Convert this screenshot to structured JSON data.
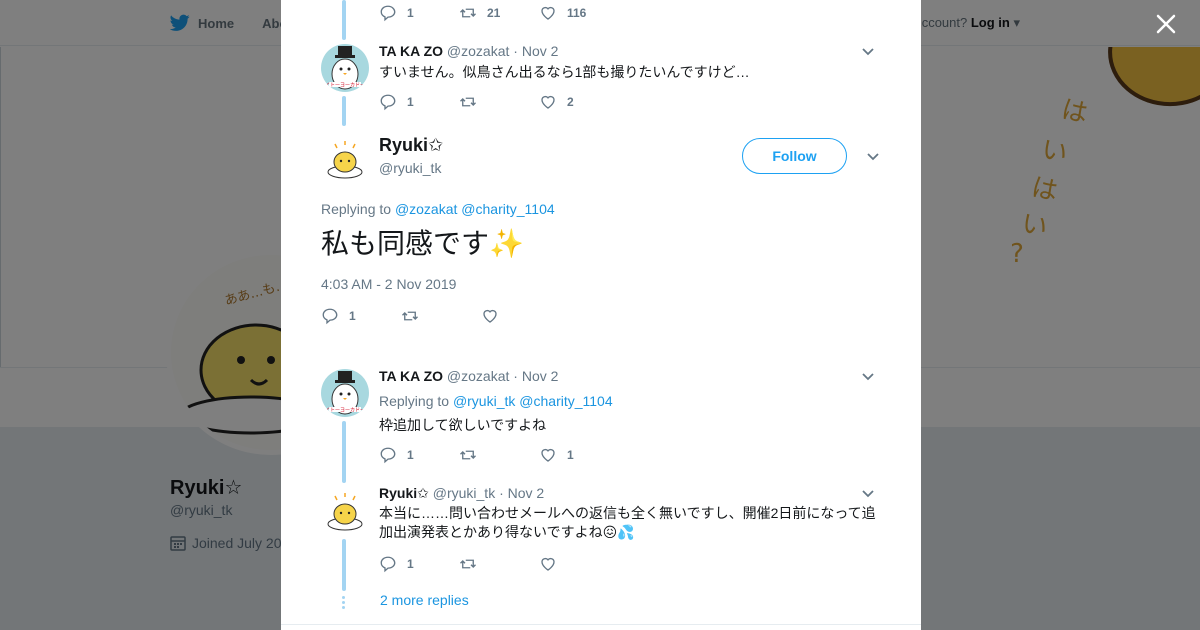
{
  "background": {
    "nav": {
      "home": "Home",
      "about": "Abo"
    },
    "login": {
      "prompt": "ccount?",
      "login_label": "Log in"
    },
    "banner_text": "はいはい？",
    "avatar_caption": "ああ…も…",
    "profile": {
      "name": "Ryuki☆",
      "handle": "@ryuki_tk",
      "joined": "Joined July 20"
    }
  },
  "close_label": "×",
  "thread": {
    "top_actions": {
      "replies": "1",
      "retweets": "21",
      "likes": "116"
    },
    "tweet1": {
      "name": "TA KA ZO",
      "handle": "@zozakat",
      "date": "· Nov 2",
      "text": "すいません。似鳥さん出るなら1部も撮りたいんですけど…",
      "replies": "1",
      "retweets": "",
      "likes": "2"
    },
    "main": {
      "name": "Ryuki✩",
      "handle": "@ryuki_tk",
      "follow_label": "Follow",
      "replying_prefix": "Replying to",
      "replying_1": "@zozakat",
      "replying_2": "@charity_1104",
      "text": "私も同感です",
      "emoji": "✨",
      "timestamp": "4:03 AM - 2 Nov 2019",
      "replies": "1",
      "retweets": "",
      "likes": ""
    },
    "tweet2": {
      "name": "TA KA ZO",
      "handle": "@zozakat",
      "date": "· Nov 2",
      "replying_prefix": "Replying to",
      "replying_1": "@ryuki_tk",
      "replying_2": "@charity_1104",
      "text": "枠追加して欲しいですよね",
      "replies": "1",
      "retweets": "",
      "likes": "1"
    },
    "tweet3": {
      "name": "Ryuki✩",
      "handle": "@ryuki_tk",
      "date": "· Nov 2",
      "text": "本当に……問い合わせメールへの返信も全く無いですし、開催2日前になって追加出演発表とかあり得ないですよね",
      "emoji_1": "😖",
      "emoji_2": "💦",
      "replies": "1",
      "retweets": "",
      "likes": ""
    },
    "more_replies": "2 more replies"
  },
  "colors": {
    "accent": "#1da1f2",
    "link": "#1b95e0",
    "thread_line": "#a3d4f2",
    "muted": "#657786"
  },
  "icons": [
    "twitter-bird-icon",
    "close-icon",
    "reply-icon",
    "retweet-icon",
    "like-icon",
    "chevron-down-icon",
    "calendar-icon"
  ]
}
